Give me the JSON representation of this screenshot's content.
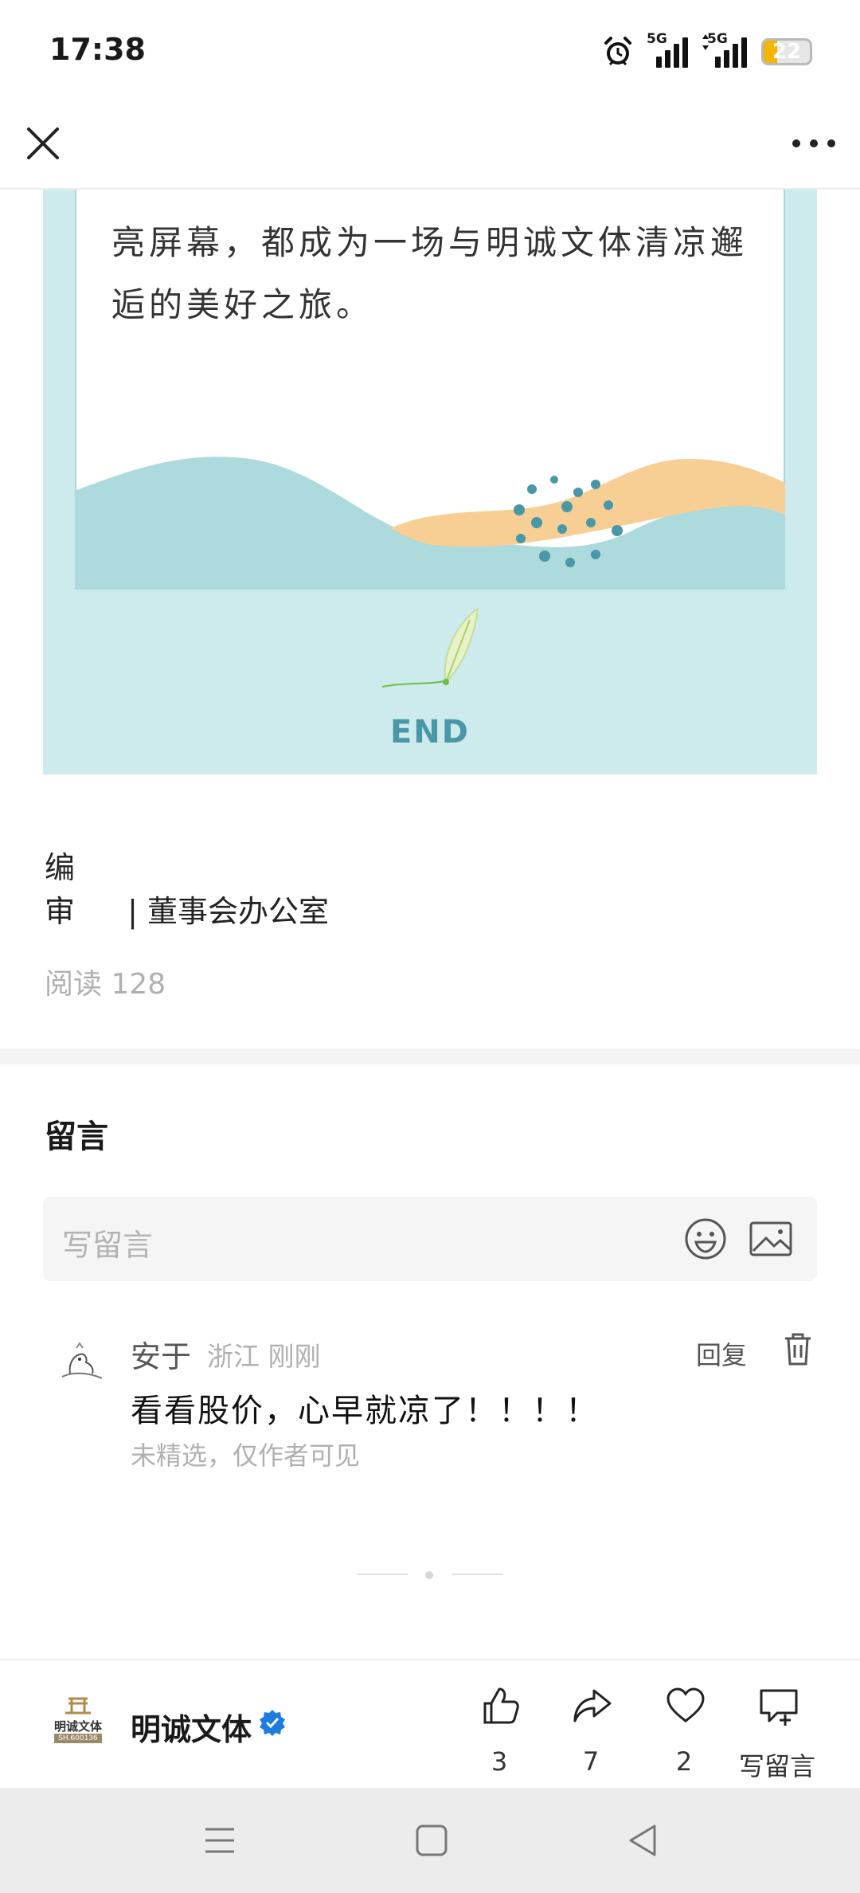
{
  "status_bar": {
    "time": "17:38",
    "signal1_label": "5G",
    "signal2_label": "5G",
    "battery": "22"
  },
  "article": {
    "text_lines": [
      "亮屏幕，都成为一场与明诚文体清凉邂",
      "逅的美好之旅。"
    ],
    "end_label": "END",
    "editor_label": "编　审",
    "editor_value": "| 董事会办公室",
    "read_count": "阅读 128"
  },
  "comments": {
    "title": "留言",
    "input_placeholder": "写留言",
    "items": [
      {
        "name": "安于",
        "meta": "浙江 刚刚",
        "reply_label": "回复",
        "text": "看看股价，心早就凉了！！！！",
        "note": "未精选，仅作者可见"
      }
    ]
  },
  "bottom_bar": {
    "account_name": "明诚文体",
    "logo_text": "明诚文体",
    "logo_code": "SH.600136",
    "like_count": "3",
    "share_count": "7",
    "favorite_count": "2",
    "write_comment_label": "写留言"
  },
  "colors": {
    "card_bg": "#cdeaed",
    "wave_teal": "#acdadd",
    "wave_orange": "#f7cf94",
    "dot": "#4a97a8",
    "verified": "#1e7ce0"
  }
}
